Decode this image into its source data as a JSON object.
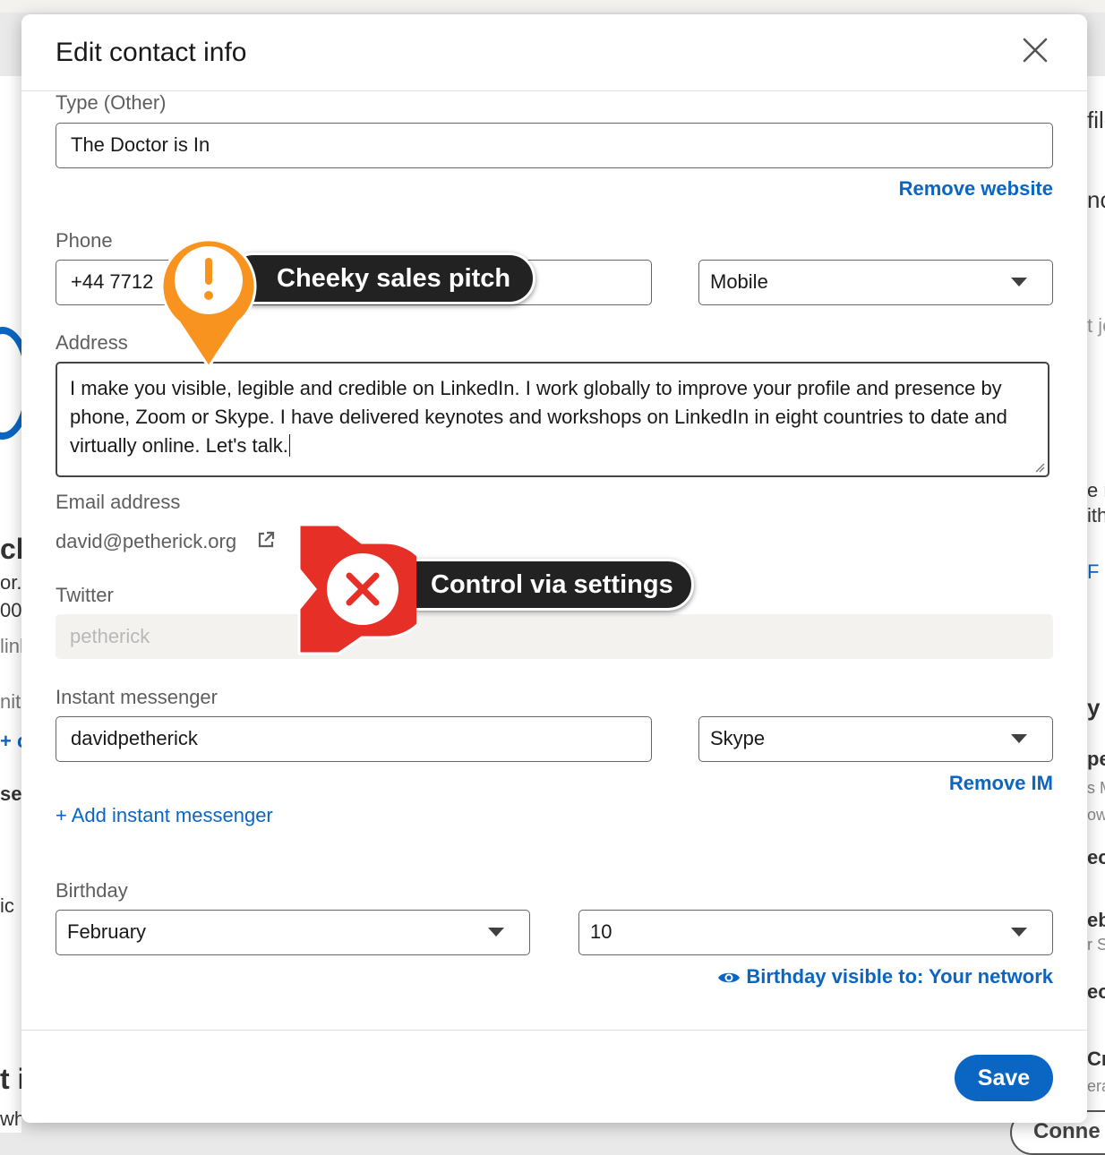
{
  "modal": {
    "title": "Edit contact info",
    "website": {
      "type_label": "Type (Other)",
      "value": "The Doctor is In",
      "remove_label": "Remove website"
    },
    "phone": {
      "label": "Phone",
      "value": "+44 7712",
      "type": "Mobile"
    },
    "address": {
      "label": "Address",
      "value": "I make you visible, legible and credible on LinkedIn. I work globally to improve your profile and presence by phone, Zoom or Skype. I have delivered keynotes and workshops on LinkedIn in eight countries to date and virtually online. Let's talk."
    },
    "email": {
      "label": "Email address",
      "value": "david@petherick.org"
    },
    "twitter": {
      "label": "Twitter",
      "value": "petherick"
    },
    "im": {
      "label": "Instant messenger",
      "value": "davidpetherick",
      "type": "Skype",
      "remove_label": "Remove IM",
      "add_label": "+ Add instant messenger"
    },
    "birthday": {
      "label": "Birthday",
      "month": "February",
      "day": "10",
      "visibility_label": "Birthday visible to: Your network"
    },
    "save_label": "Save"
  },
  "annotations": {
    "sales_pitch": "Cheeky sales pitch",
    "settings": "Control via settings"
  },
  "background": {
    "right_fragments": [
      "file",
      "nc",
      "t jo",
      "e n",
      "ith",
      "F",
      "y k",
      "pe",
      "s M",
      "ow",
      "ec",
      "eb",
      "r S",
      "ec",
      "Cr",
      "era"
    ],
    "left_fragments": [
      "ck",
      "or.",
      "00",
      "link",
      "nite",
      "+ c",
      "se",
      "ic",
      "t i",
      "wh"
    ],
    "connect_label": "Conne"
  },
  "colors": {
    "accent": "#0a66c2",
    "warning_marker": "#f7931e",
    "error_marker": "#e63027"
  },
  "icons": {
    "close": "close-icon",
    "external_link": "external-link-icon",
    "eye": "eye-icon",
    "caret": "caret-down-icon",
    "warning": "exclamation-marker-icon",
    "error": "x-marker-icon"
  }
}
